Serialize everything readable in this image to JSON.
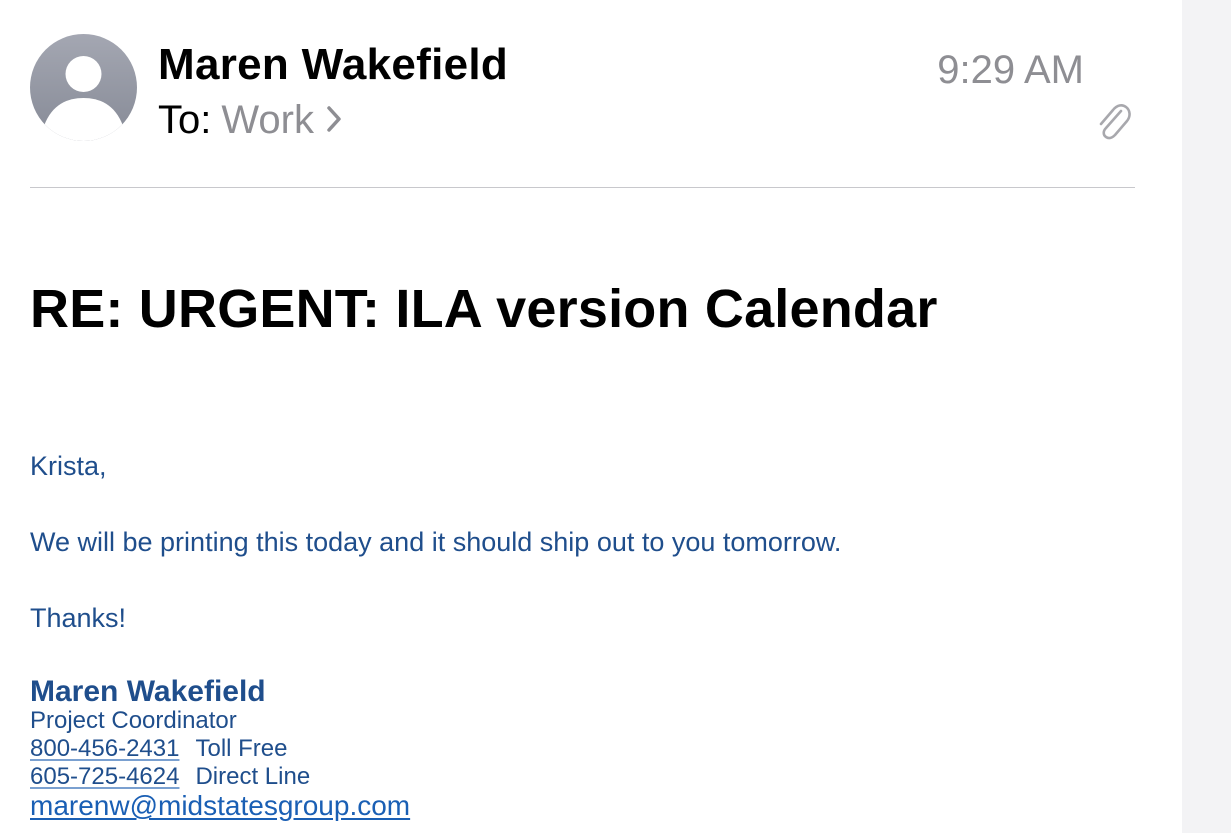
{
  "header": {
    "sender_name": "Maren Wakefield",
    "to_label": "To:",
    "to_value": "Work",
    "time": "9:29 AM",
    "avatar_icon": "person-placeholder-icon",
    "chevron_icon": "chevron-right-icon",
    "attachment_icon": "paperclip-icon"
  },
  "email": {
    "subject": "RE: URGENT: ILA version Calendar",
    "greeting": "Krista,",
    "message": "We will be printing this today and it should ship out to you tomorrow.",
    "signoff": "Thanks!"
  },
  "signature": {
    "name": "Maren Wakefield",
    "title": "Project Coordinator",
    "phones": [
      {
        "number": "800-456-2431",
        "label": "Toll Free"
      },
      {
        "number": "605-725-4624",
        "label": "Direct Line"
      }
    ],
    "email": "marenw@midstatesgroup.com"
  },
  "colors": {
    "body_text": "#1f4e8c",
    "link": "#1a5fb4",
    "secondary_text": "#8e8e93",
    "divider": "#c8c8cc"
  }
}
